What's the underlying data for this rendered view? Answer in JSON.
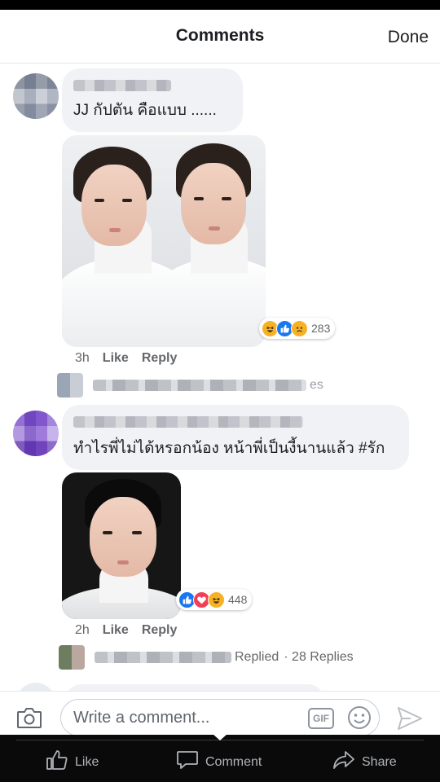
{
  "header": {
    "title": "Comments",
    "done_label": "Done"
  },
  "comments": [
    {
      "text": "JJ กัปตัน คือแบบ ......",
      "time": "3h",
      "like_label": "Like",
      "reply_label": "Reply",
      "reaction_count": "283",
      "reactions": [
        "haha-icon",
        "like-icon",
        "sad-icon"
      ],
      "reply_summary": "es"
    },
    {
      "text": "ทำไรพี่ไม่ได้หรอกน้อง หน้าพี่เป็นงี้นานแล้ว #รัก",
      "time": "2h",
      "like_label": "Like",
      "reply_label": "Reply",
      "reaction_count": "448",
      "reactions": [
        "like-icon",
        "love-icon",
        "haha-icon"
      ],
      "reply_summary": "Replied",
      "reply_count": "· 28 Replies"
    }
  ],
  "composer": {
    "placeholder": "Write a comment...",
    "gif_label": "GIF"
  },
  "tabbar": {
    "like": "Like",
    "comment": "Comment",
    "share": "Share"
  },
  "colors": {
    "accent": "#1877f2",
    "love": "#f33e58",
    "haha": "#f7b125",
    "bubble": "#f0f2f5",
    "tabbar": "#0a0a0a"
  }
}
